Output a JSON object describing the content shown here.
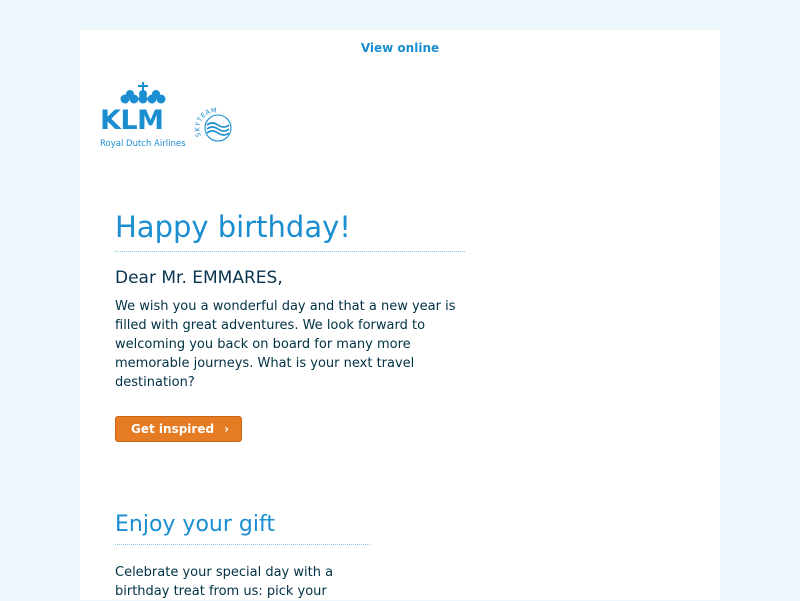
{
  "header": {
    "view_online": "View online"
  },
  "logo": {
    "brand": "KLM",
    "tagline": "Royal Dutch Airlines",
    "alliance": "SKYTEAM",
    "brand_color": "#1a8ed1"
  },
  "main": {
    "title": "Happy birthday!",
    "greeting": "Dear Mr. EMMARES,",
    "body": "We wish you a wonderful day and that a new year is filled with great adventures. We look forward to welcoming you back on board for many more memorable journeys. What is your next travel destination?",
    "cta_label": "Get inspired",
    "cta_icon": "chevron-right-icon",
    "cta_color": "#e57b22"
  },
  "gift": {
    "title": "Enjoy your gift",
    "body": "Celebrate your special day with a birthday treat from us: pick your"
  }
}
